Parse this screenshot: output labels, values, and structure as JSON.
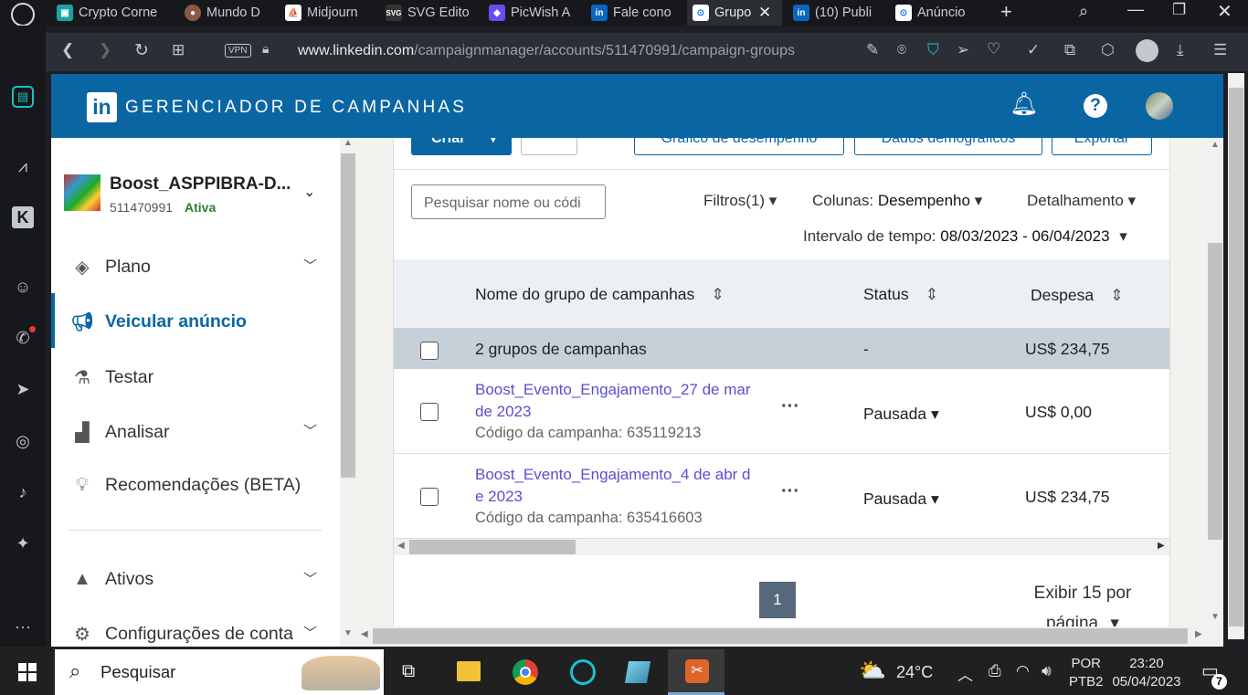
{
  "browser": {
    "tabs": [
      {
        "label": "Crypto Corne",
        "color": "#1aa3a3"
      },
      {
        "label": "Mundo D",
        "color": "#8a5a44"
      },
      {
        "label": "Midjourn",
        "color": "#555555"
      },
      {
        "label": "SVG Edito",
        "color": "#333333"
      },
      {
        "label": "PicWish A",
        "color": "#6a4cf0"
      },
      {
        "label": "Fale cono",
        "color": "#0a66c2"
      },
      {
        "label": "Grupo",
        "color": "#1a73e8"
      },
      {
        "label": "(10) Publi",
        "color": "#0a66c2"
      },
      {
        "label": "Anúncio",
        "color": "#1a73e8"
      }
    ],
    "new_tab": "+",
    "vpn_label": "VPN",
    "url_host": "www.linkedin.com",
    "url_path": "/campaignmanager/accounts/511470991/campaign-groups"
  },
  "header": {
    "logo_text": "in",
    "brand": "GERENCIADOR DE CAMPANHAS",
    "help": "?"
  },
  "account": {
    "name": "Boost_ASPPIBRA-D...",
    "id": "511470991",
    "status": "Ativa"
  },
  "nav": {
    "items": [
      {
        "label": "Plano",
        "active": false
      },
      {
        "label": "Veicular anúncio",
        "active": true
      },
      {
        "label": "Testar",
        "active": false
      },
      {
        "label": "Analisar",
        "active": false
      },
      {
        "label": "Recomendações (BETA)",
        "active": false
      },
      {
        "label": "Ativos",
        "active": false
      },
      {
        "label": "Configurações de conta",
        "active": false
      }
    ]
  },
  "toolbar": {
    "create": "Criar",
    "performance_chart": "Gráfico de desempenho",
    "demographics": "Dados demográficos",
    "export": "Exportar",
    "search_placeholder": "Pesquisar nome ou códi",
    "filters": "Filtros(1)",
    "columns_label": "Colunas:",
    "columns_value": "Desempenho",
    "breakdown": "Detalhamento",
    "time_range_label": "Intervalo de tempo:",
    "time_range_value": "08/03/2023 - 06/04/2023"
  },
  "table": {
    "headers": [
      "Nome do grupo de campanhas",
      "Status",
      "Despesa"
    ],
    "summary": {
      "name": "2 grupos de campanhas",
      "status": "-",
      "spend": "US$ 234,75"
    },
    "rows": [
      {
        "name_l1": "Boost_Evento_Engajamento_27 de mar",
        "name_l2": "de 2023",
        "code": "Código da campanha: 635119213",
        "status": "Pausada",
        "spend": "US$ 0,00"
      },
      {
        "name_l1": "Boost_Evento_Engajamento_4 de abr d",
        "name_l2": "e 2023",
        "code": "Código da campanha: 635416603",
        "status": "Pausada",
        "spend": "US$ 234,75"
      }
    ]
  },
  "pagination": {
    "page": "1",
    "per_page_l1": "Exibir 15 por",
    "per_page_l2": "página"
  },
  "taskbar": {
    "search": "Pesquisar",
    "weather": "24°C",
    "lang_l1": "POR",
    "lang_l2": "PTB2",
    "time": "23:20",
    "date": "05/04/2023",
    "notifications": "7"
  }
}
